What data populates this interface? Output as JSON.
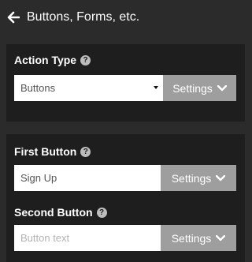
{
  "header": {
    "title": "Buttons, Forms, etc."
  },
  "action_type": {
    "label": "Action Type",
    "selected": "Buttons",
    "settings_label": "Settings"
  },
  "first_button": {
    "label": "First Button",
    "value": "Sign Up",
    "settings_label": "Settings"
  },
  "second_button": {
    "label": "Second Button",
    "placeholder": "Button text",
    "settings_label": "Settings"
  },
  "help_glyph": "?"
}
